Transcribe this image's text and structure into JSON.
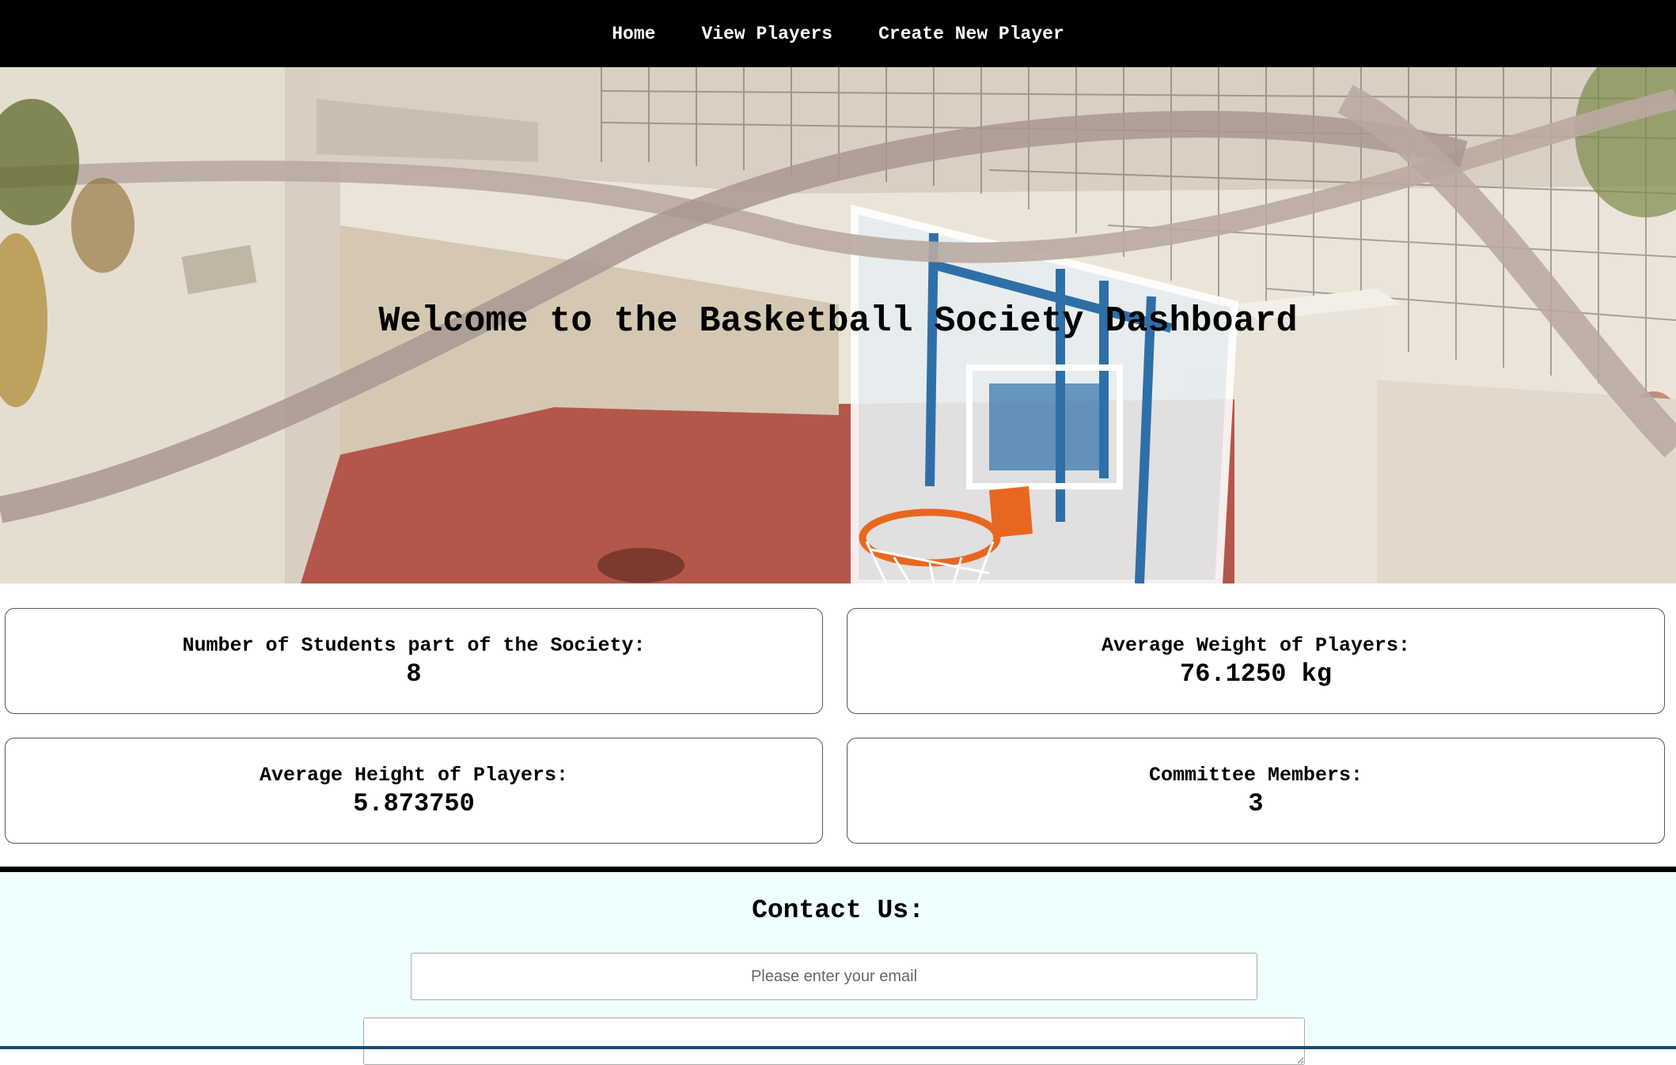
{
  "nav": {
    "items": [
      {
        "label": "Home"
      },
      {
        "label": "View Players"
      },
      {
        "label": "Create New Player"
      }
    ]
  },
  "hero": {
    "title": "Welcome to the Basketball Society Dashboard"
  },
  "stats": [
    {
      "label": "Number of Students part of the Society:",
      "value": "8"
    },
    {
      "label": "Average Weight of Players:",
      "value": "76.1250 kg"
    },
    {
      "label": "Average Height of Players:",
      "value": "5.873750"
    },
    {
      "label": "Committee Members:",
      "value": "3"
    }
  ],
  "contact": {
    "title": "Contact Us:",
    "email_placeholder": "Please enter your email"
  },
  "colors": {
    "nav_bg": "#000000",
    "contact_bg": "#effffe",
    "backboard_blue": "#2f6fa8",
    "rim_orange": "#e8671f",
    "court_red": "#b3574a"
  }
}
